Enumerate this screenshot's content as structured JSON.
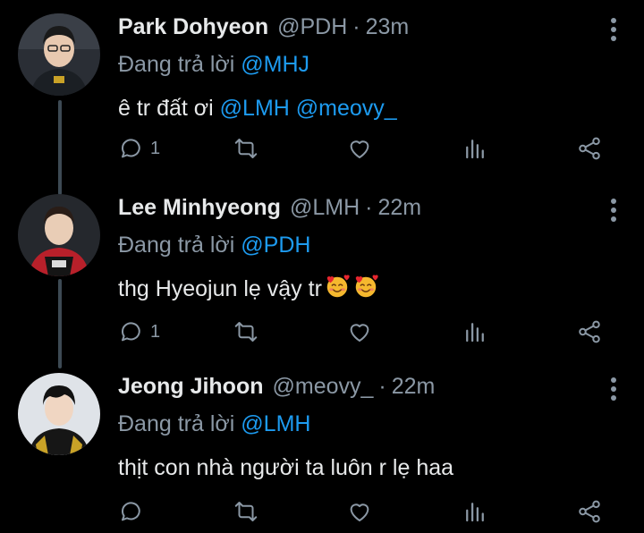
{
  "tweets": [
    {
      "name": "Park Dohyeon",
      "handle": "@PDH",
      "sep": "·",
      "time": "23m",
      "replying_prefix": "Đang trả lời",
      "replying_to": "@MHJ",
      "text_before": "ê tr đất ơi",
      "mentions": [
        "@LMH",
        "@meovy_"
      ],
      "reply_count": "1"
    },
    {
      "name": "Lee Minhyeong",
      "handle": "@LMH",
      "sep": "·",
      "time": "22m",
      "replying_prefix": "Đang trả lời",
      "replying_to": "@PDH",
      "text": "thg Hyeojun lẹ vậy tr",
      "emojis": [
        "smiling-face-with-hearts",
        "smiling-face-with-hearts"
      ],
      "reply_count": "1"
    },
    {
      "name": "Jeong Jihoon",
      "handle": "@meovy_",
      "sep": "·",
      "time": "22m",
      "replying_prefix": "Đang trả lời",
      "replying_to": "@LMH",
      "text": "thịt con nhà người ta luôn r lẹ haa",
      "reply_count": ""
    }
  ],
  "colors": {
    "background": "#000000",
    "text": "#e7e9ea",
    "secondary": "#8b98a5",
    "link": "#1d9bf0",
    "thread_line": "#3d4a54"
  }
}
